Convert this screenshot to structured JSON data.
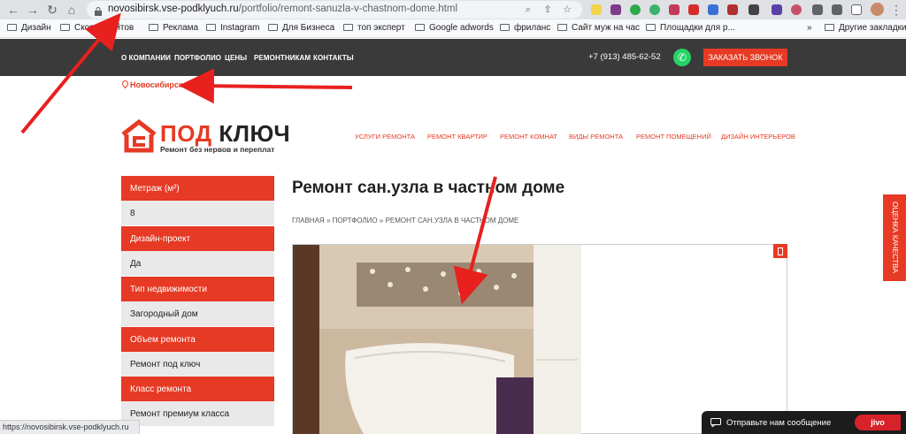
{
  "browser": {
    "url_host": "novosibirsk.vse-podklyuch.ru",
    "url_path": "/portfolio/remont-sanuzla-v-chastnom-dome.html",
    "bookmarks": [
      "Дизайн",
      "Скорост  айтов",
      "Реклама",
      "Instagram",
      "Для Бизнеса",
      "топ эксперт",
      "Google adwords",
      "фриланс",
      "Сайт муж на час",
      "Площадки  для р..."
    ],
    "bookmarks_more": "»",
    "other_bookmarks": "Другие закладки",
    "status_url": "https://novosibirsk.vse-podklyuch.ru"
  },
  "site": {
    "nav": [
      "О КОМПАНИИ",
      "ПОРТФОЛИО",
      "ЦЕНЫ",
      "РЕМОНТНИКАМ",
      "КОНТАКТЫ"
    ],
    "phone": "+7 (913) 485-62-52",
    "call_button": "ЗАКАЗАТЬ ЗВОНОК",
    "city": "Новосибирск",
    "logo_title_first": "ПОД",
    "logo_title_second": "КЛЮЧ",
    "logo_subtitle": "Ремонт без нервов и переплат",
    "menu": [
      "УСЛУГИ РЕМОНТА",
      "РЕМОНТ КВАРТИР",
      "РЕМОНТ КОМНАТ",
      "ВИДЫ РЕМОНТА",
      "РЕМОНТ ПОМЕЩЕНИЙ",
      "ДИЗАЙН ИНТЕРЬЕРОВ"
    ]
  },
  "sidebar": [
    {
      "label": "Метраж (м²)",
      "value": "8"
    },
    {
      "label": "Дизайн-проект",
      "value": "Да"
    },
    {
      "label": "Тип недвижимости",
      "value": "Загородный дом"
    },
    {
      "label": "Объем ремонта",
      "value": "Ремонт под ключ"
    },
    {
      "label": "Класс ремонта",
      "value": "Ремонт премиум класса"
    }
  ],
  "page": {
    "title": "Ремонт сан.узла в частном доме",
    "breadcrumb": [
      "ГЛАВНАЯ",
      "ПОРТФОЛИО",
      "РЕМОНТ САН.УЗЛА В ЧАСТНОМ ДОМЕ"
    ],
    "breadcrumb_sep": "»"
  },
  "widgets": {
    "rating_tab": "ОЦЕНКА КАЧЕСТВА",
    "chat_text": "Отправьте нам сообщение",
    "chat_brand": "jivo"
  },
  "colors": {
    "accent": "#e63a24",
    "nav_bg": "#3a3a3a",
    "annotation_arrow": "#e8201e"
  }
}
